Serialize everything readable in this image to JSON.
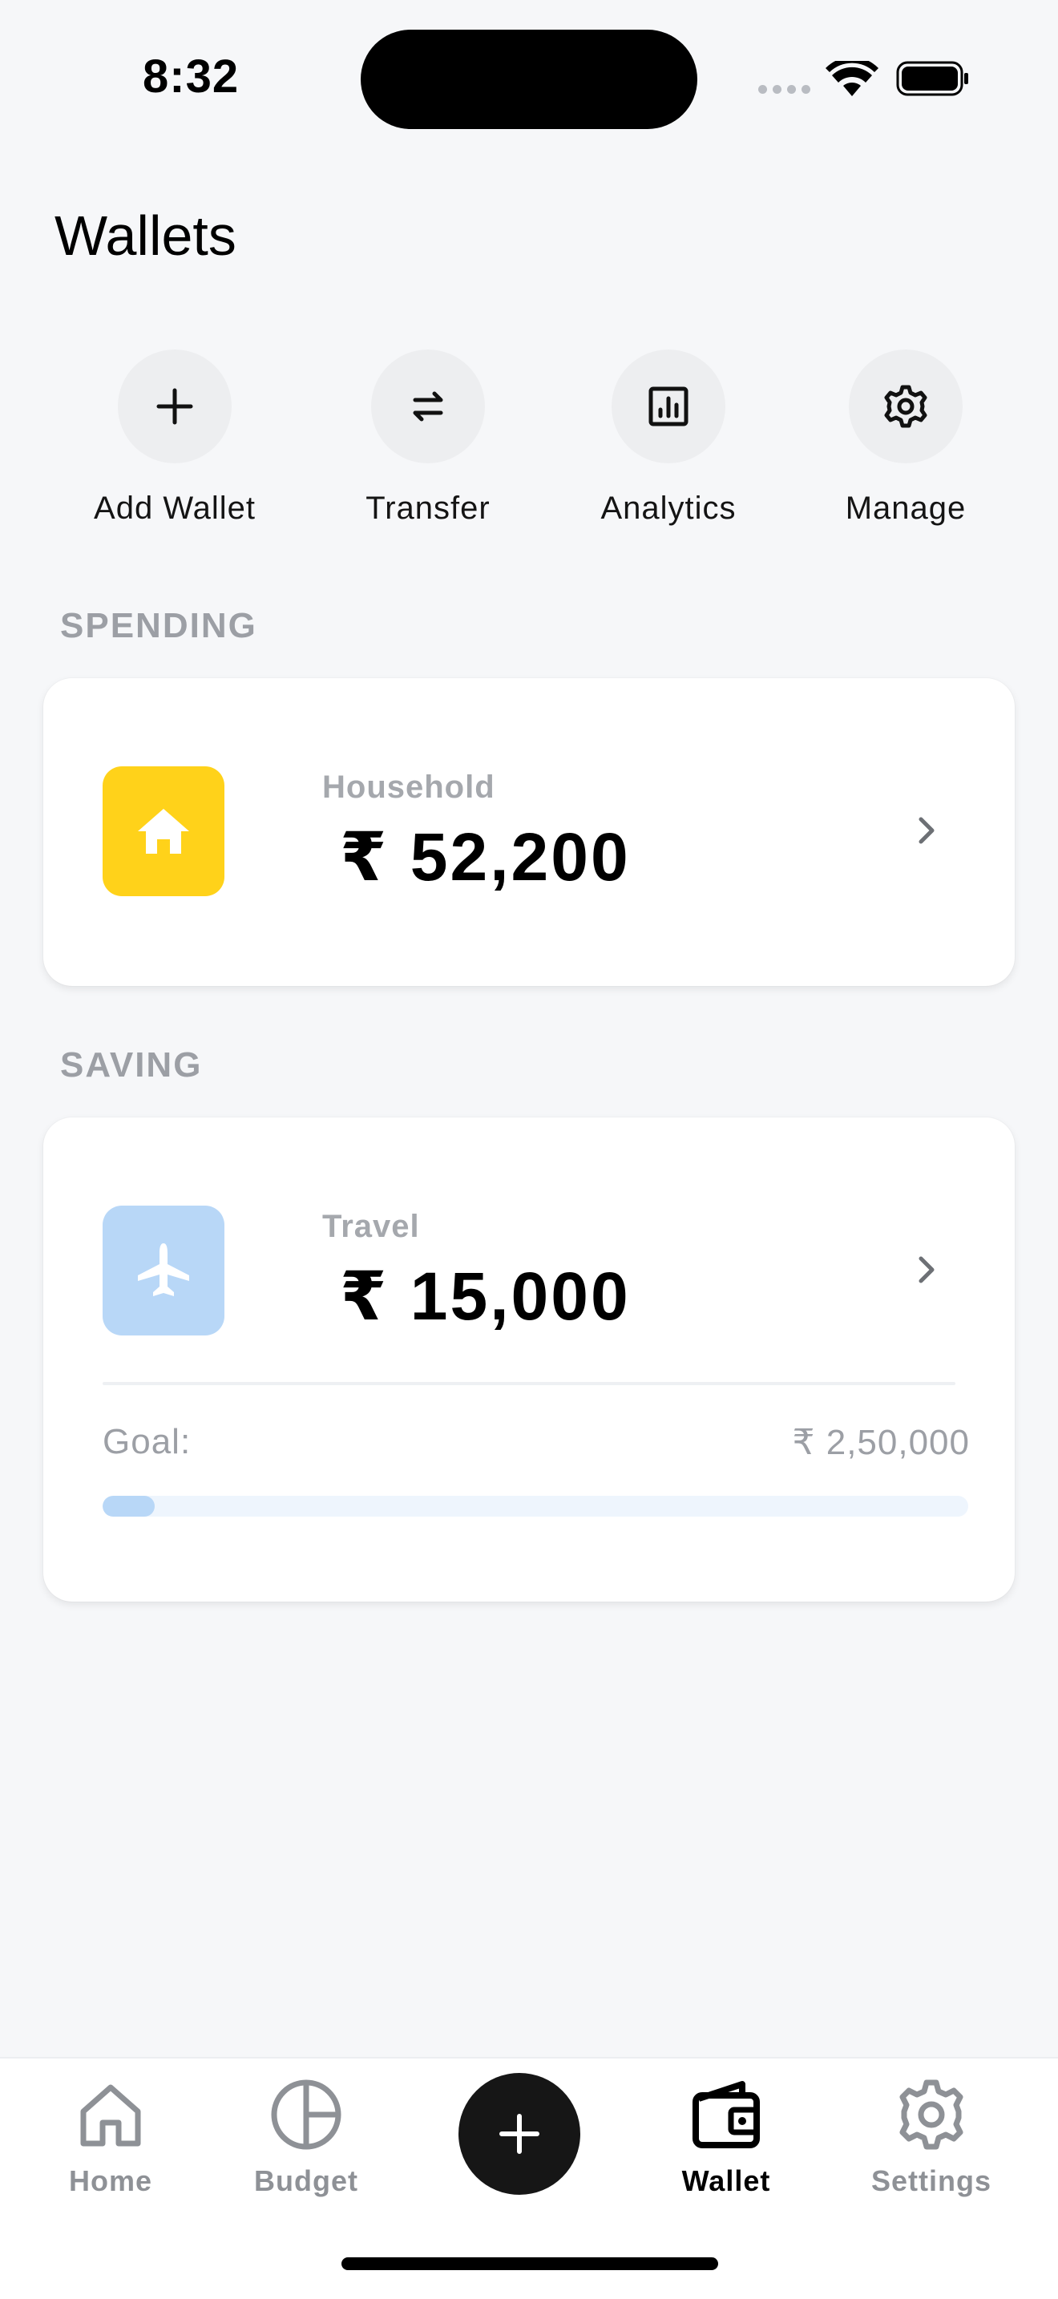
{
  "status_bar": {
    "time": "8:32"
  },
  "page": {
    "title": "Wallets"
  },
  "actions": [
    {
      "label": "Add Wallet",
      "icon": "plus-icon"
    },
    {
      "label": "Transfer",
      "icon": "transfer-arrows-icon"
    },
    {
      "label": "Analytics",
      "icon": "analytics-chart-icon"
    },
    {
      "label": "Manage",
      "icon": "gear-icon"
    }
  ],
  "sections": {
    "spending": {
      "header": "SPENDING",
      "wallet": {
        "name": "Household",
        "amount": "₹ 52,200",
        "icon": "house-icon",
        "icon_bg": "#FFD21A"
      }
    },
    "saving": {
      "header": "SAVING",
      "wallet": {
        "name": "Travel",
        "amount": "₹ 15,000",
        "icon": "airplane-icon",
        "icon_bg": "#B8D7F7",
        "goal_label": "Goal:",
        "goal_value": "₹ 2,50,000",
        "progress": 0.06
      }
    }
  },
  "bottom_nav": {
    "items": [
      {
        "label": "Home",
        "icon": "home-icon",
        "active": false
      },
      {
        "label": "Budget",
        "icon": "pie-chart-icon",
        "active": false
      },
      {
        "label": "Wallet",
        "icon": "wallet-icon",
        "active": true
      },
      {
        "label": "Settings",
        "icon": "gear-icon",
        "active": false
      }
    ],
    "add_icon": "plus-icon"
  },
  "colors": {
    "background": "#F6F7F9",
    "accent_dark": "#161616",
    "muted_text": "#9C9FA5"
  }
}
